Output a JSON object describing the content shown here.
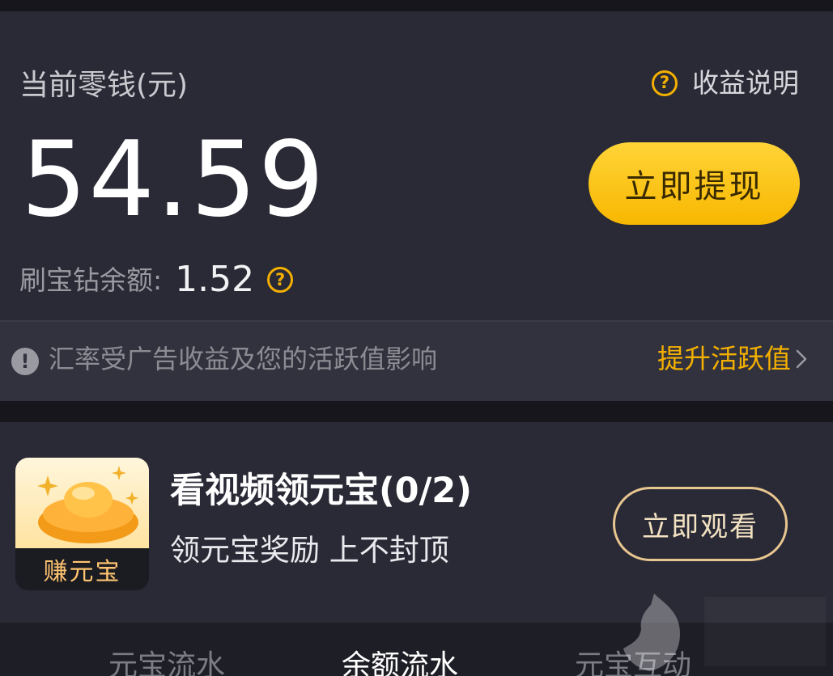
{
  "balance": {
    "label": "当前零钱(元)",
    "help_label": "收益说明",
    "amount": "54.59",
    "withdraw_button": "立即提现",
    "diamond_label": "刷宝钻余额:",
    "diamond_value": "1.52"
  },
  "info_bar": {
    "text": "汇率受广告收益及您的活跃值影响",
    "link_label": "提升活跃值"
  },
  "task": {
    "icon_label": "赚元宝",
    "title": "看视频领元宝(0/2)",
    "subtitle": "领元宝奖励 上不封顶",
    "button": "立即观看"
  },
  "tabs": [
    {
      "label": "元宝流水",
      "active": false
    },
    {
      "label": "余额流水",
      "active": true
    },
    {
      "label": "元宝互动",
      "active": false
    }
  ],
  "colors": {
    "accent_gold": "#f4b000",
    "card_bg": "#2a2a36",
    "page_bg": "#16161c"
  },
  "icons": [
    "question-icon",
    "warning-icon",
    "chevron-right-icon",
    "gold-ingot-icon"
  ]
}
